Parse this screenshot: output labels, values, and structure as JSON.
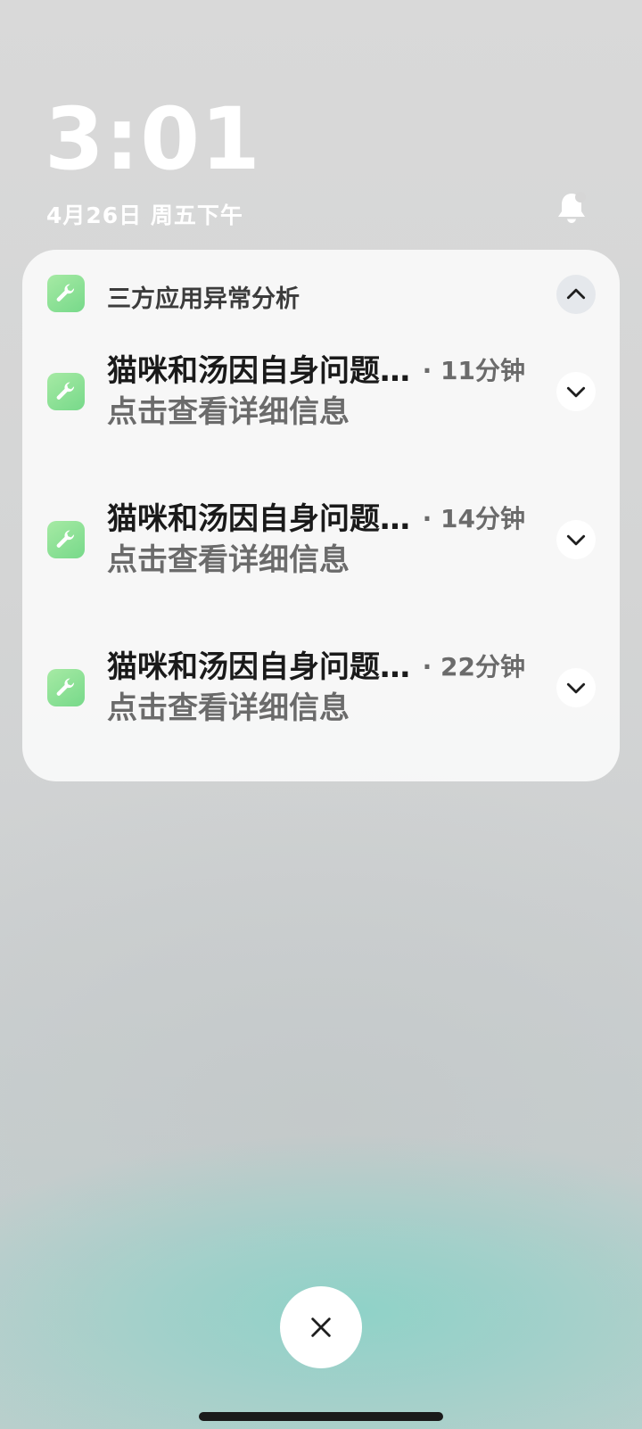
{
  "lockscreen": {
    "time": "3:01",
    "date": "4月26日 周五下午"
  },
  "notification_group": {
    "app_name": "三方应用异常分析",
    "items": [
      {
        "title": "猫咪和汤因自身问题停止运行",
        "time": "· 11分钟",
        "body": "点击查看详细信息"
      },
      {
        "title": "猫咪和汤因自身问题停止运行",
        "time": "· 14分钟",
        "body": "点击查看详细信息"
      },
      {
        "title": "猫咪和汤因自身问题停止运行",
        "time": "· 22分钟",
        "body": "点击查看详细信息"
      }
    ]
  },
  "icons": {
    "app": "wrench-icon",
    "bell": "bell-icon",
    "collapse": "chevron-up-icon",
    "expand": "chevron-down-icon",
    "close": "close-icon"
  },
  "colors": {
    "card_bg": "#f8f8f8",
    "app_icon_green": "#77d98a",
    "title_text": "#1a1a1a",
    "secondary_text": "#6b6b6b"
  }
}
